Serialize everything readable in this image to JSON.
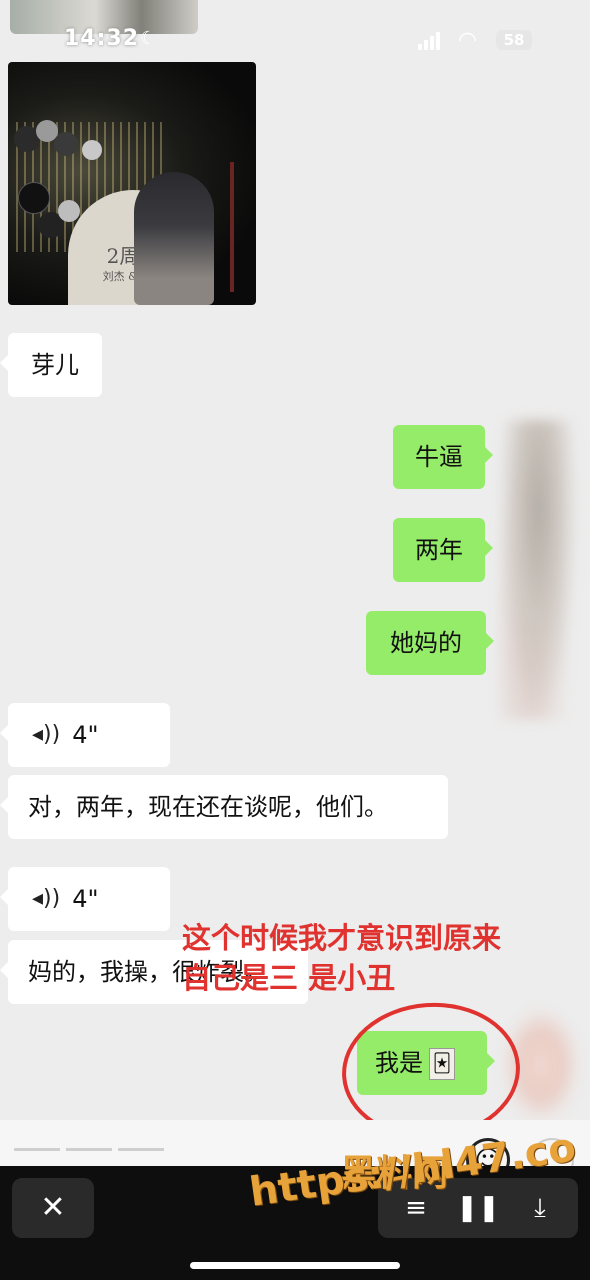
{
  "status": {
    "time": "14:32",
    "battery": "58"
  },
  "photo_text": {
    "anniv": "2周年",
    "names": "刘杰 & 谭竹"
  },
  "messages": {
    "m1": "芽儿",
    "m2": "牛逼",
    "m3": "两年",
    "m4": "她妈的",
    "m5_duration": "4\"",
    "m6": "对，两年，现在还在谈呢，他们。",
    "m7_duration": "4\"",
    "m8": "妈的，我操，很炸裂。",
    "m9": "我是"
  },
  "annotation": {
    "line1": "这个时候我才意识到原来",
    "line2": "自己是三 是小丑"
  },
  "toolbar": {
    "close_symbol": "✕"
  },
  "watermark": {
    "name": "黑料网",
    "url": "https://hl47.co"
  },
  "colors": {
    "chat_bg": "#ededed",
    "my_bubble": "#95ec69",
    "their_bubble": "#ffffff",
    "annotation": "#e0322f",
    "watermark": "#e8a23a"
  },
  "icons": [
    "moon-icon",
    "signal-icon",
    "wifi-icon",
    "battery-icon",
    "voice-icon",
    "joker-card-icon",
    "emoji-icon",
    "close-icon",
    "list-icon",
    "pause-icon",
    "download-icon"
  ]
}
